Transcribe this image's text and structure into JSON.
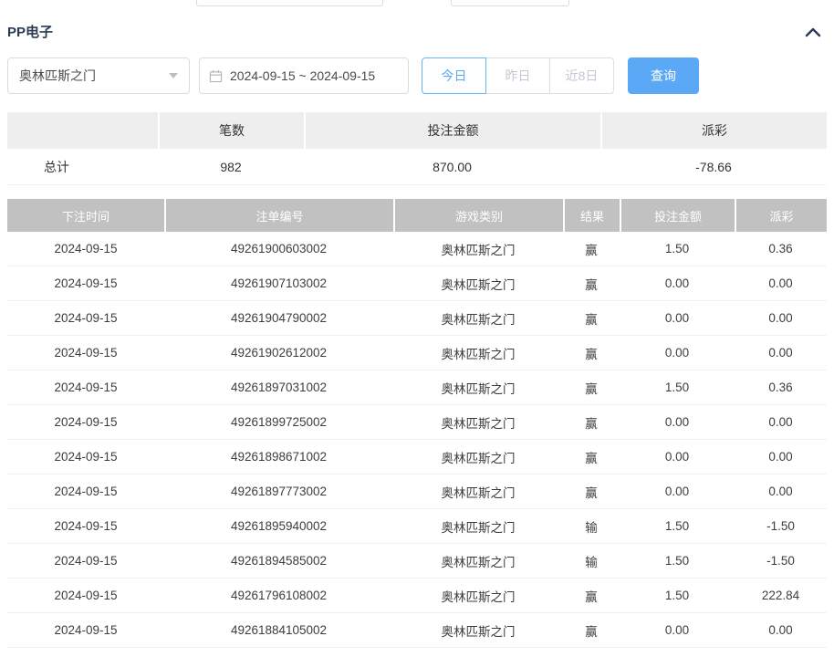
{
  "panel": {
    "title": "PP电子"
  },
  "filters": {
    "game_select_value": "奥林匹斯之门",
    "date_range_value": "2024-09-15 ~ 2024-09-15",
    "quick_buttons": [
      {
        "label": "今日",
        "active": true
      },
      {
        "label": "昨日",
        "active": false
      },
      {
        "label": "近8日",
        "active": false
      }
    ],
    "query_label": "查询"
  },
  "summary": {
    "headers": [
      "",
      "笔数",
      "投注金额",
      "派彩"
    ],
    "total": {
      "label": "总计",
      "count": "982",
      "bet_amount": "870.00",
      "payout": "-78.66"
    }
  },
  "table": {
    "headers": [
      "下注时间",
      "注单编号",
      "游戏类别",
      "结果",
      "投注金额",
      "派彩"
    ],
    "rows": [
      [
        "2024-09-15",
        "49261900603002",
        "奥林匹斯之门",
        "赢",
        "1.50",
        "0.36"
      ],
      [
        "2024-09-15",
        "49261907103002",
        "奥林匹斯之门",
        "赢",
        "0.00",
        "0.00"
      ],
      [
        "2024-09-15",
        "49261904790002",
        "奥林匹斯之门",
        "赢",
        "0.00",
        "0.00"
      ],
      [
        "2024-09-15",
        "49261902612002",
        "奥林匹斯之门",
        "赢",
        "0.00",
        "0.00"
      ],
      [
        "2024-09-15",
        "49261897031002",
        "奥林匹斯之门",
        "赢",
        "1.50",
        "0.36"
      ],
      [
        "2024-09-15",
        "49261899725002",
        "奥林匹斯之门",
        "赢",
        "0.00",
        "0.00"
      ],
      [
        "2024-09-15",
        "49261898671002",
        "奥林匹斯之门",
        "赢",
        "0.00",
        "0.00"
      ],
      [
        "2024-09-15",
        "49261897773002",
        "奥林匹斯之门",
        "赢",
        "0.00",
        "0.00"
      ],
      [
        "2024-09-15",
        "49261895940002",
        "奥林匹斯之门",
        "输",
        "1.50",
        "-1.50"
      ],
      [
        "2024-09-15",
        "49261894585002",
        "奥林匹斯之门",
        "输",
        "1.50",
        "-1.50"
      ],
      [
        "2024-09-15",
        "49261796108002",
        "奥林匹斯之门",
        "赢",
        "1.50",
        "222.84"
      ],
      [
        "2024-09-15",
        "49261884105002",
        "奥林匹斯之门",
        "赢",
        "0.00",
        "0.00"
      ]
    ]
  },
  "colors": {
    "accent_blue": "#5ba9f6",
    "active_button_blue": "#6db3f8",
    "negative_red": "#f0524f",
    "table_header_gray": "#c1c1c1",
    "summary_header_gray": "#eeeeee"
  }
}
